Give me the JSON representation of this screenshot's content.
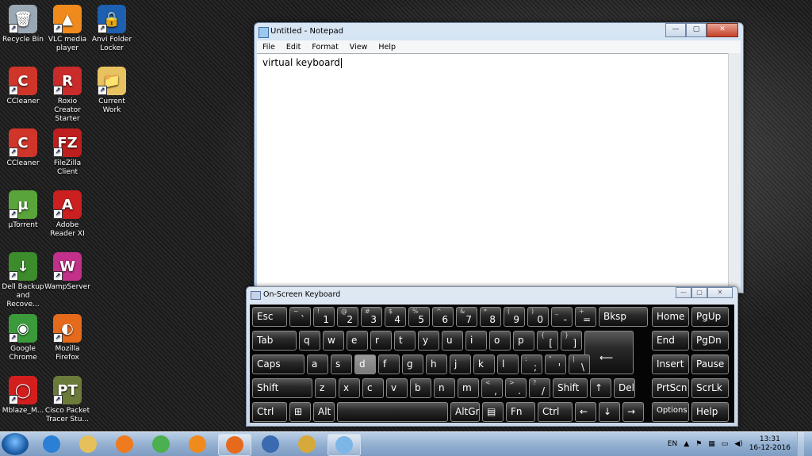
{
  "desktop": {
    "icons": [
      {
        "label": "Recycle Bin",
        "icon": "recycle-bin-icon",
        "color": "#9aa7b5",
        "glyph": "🗑"
      },
      {
        "label": "VLC media player",
        "icon": "vlc-icon",
        "color": "#f08a1c",
        "glyph": "▲"
      },
      {
        "label": "Anvi Folder Locker",
        "icon": "folder-locker-icon",
        "color": "#1d5fb0",
        "glyph": "🔒"
      },
      {
        "label": "CCleaner",
        "icon": "ccleaner-icon",
        "color": "#d0352a",
        "glyph": "C"
      },
      {
        "label": "Roxio Creator Starter",
        "icon": "roxio-icon",
        "color": "#c92b2b",
        "glyph": "R"
      },
      {
        "label": "Current Work",
        "icon": "folder-icon",
        "color": "#e8c260",
        "glyph": "📁"
      },
      {
        "label": "CCleaner",
        "icon": "ccleaner-icon",
        "color": "#d0352a",
        "glyph": "C"
      },
      {
        "label": "FileZilla Client",
        "icon": "filezilla-icon",
        "color": "#bf1e1e",
        "glyph": "FZ"
      },
      {
        "label": "µTorrent",
        "icon": "utorrent-icon",
        "color": "#5aa53a",
        "glyph": "µ"
      },
      {
        "label": "Adobe Reader XI",
        "icon": "adobe-reader-icon",
        "color": "#cc1f1f",
        "glyph": "A"
      },
      {
        "label": "Dell Backup and Recove...",
        "icon": "dell-backup-icon",
        "color": "#3c8b2c",
        "glyph": "↓"
      },
      {
        "label": "WampServer",
        "icon": "wampserver-icon",
        "color": "#c2308a",
        "glyph": "W"
      },
      {
        "label": "Google Chrome",
        "icon": "chrome-icon",
        "color": "#3b9b3b",
        "glyph": "◉"
      },
      {
        "label": "Mozilla Firefox",
        "icon": "firefox-icon",
        "color": "#e66a1c",
        "glyph": "◐"
      },
      {
        "label": "Mblaze_M...",
        "icon": "mblaze-icon",
        "color": "#d31e1e",
        "glyph": "◯"
      },
      {
        "label": "Cisco Packet Tracer Stu...",
        "icon": "packet-tracer-icon",
        "color": "#6b7b3a",
        "glyph": "PT"
      }
    ]
  },
  "notepad": {
    "title": "Untitled - Notepad",
    "menu": [
      "File",
      "Edit",
      "Format",
      "View",
      "Help"
    ],
    "text": "virtual keyboard",
    "buttons": {
      "minimize": "—",
      "maximize": "▢",
      "close": "✕"
    }
  },
  "osk": {
    "title": "On-Screen Keyboard",
    "buttons": {
      "minimize": "—",
      "maximize": "▢",
      "close": "✕"
    },
    "rows": [
      [
        {
          "main": "Esc",
          "w": 44
        },
        {
          "shift": "~",
          "low": "`",
          "w": 27
        },
        {
          "shift": "!",
          "low": "1",
          "w": 27
        },
        {
          "shift": "@",
          "low": "2",
          "w": 27
        },
        {
          "shift": "#",
          "low": "3",
          "w": 27
        },
        {
          "shift": "$",
          "low": "4",
          "w": 27
        },
        {
          "shift": "%",
          "low": "5",
          "w": 27
        },
        {
          "shift": "^",
          "low": "6",
          "w": 27
        },
        {
          "shift": "&",
          "low": "7",
          "w": 27
        },
        {
          "shift": "*",
          "low": "8",
          "w": 27
        },
        {
          "shift": "(",
          "low": "9",
          "w": 27
        },
        {
          "shift": ")",
          "low": "0",
          "w": 27
        },
        {
          "shift": "_",
          "low": "-",
          "w": 27
        },
        {
          "shift": "+",
          "low": "=",
          "w": 27
        },
        {
          "main": "Bksp",
          "w": 62
        }
      ],
      [
        {
          "main": "Tab",
          "w": 56
        },
        {
          "main": "q",
          "w": 27
        },
        {
          "main": "w",
          "w": 27
        },
        {
          "main": "e",
          "w": 27
        },
        {
          "main": "r",
          "w": 27
        },
        {
          "main": "t",
          "w": 27
        },
        {
          "main": "y",
          "w": 27
        },
        {
          "main": "u",
          "w": 27
        },
        {
          "main": "i",
          "w": 27
        },
        {
          "main": "o",
          "w": 27
        },
        {
          "main": "p",
          "w": 27
        },
        {
          "shift": "{",
          "low": "[",
          "w": 27
        },
        {
          "shift": "}",
          "low": "]",
          "w": 27
        },
        {
          "main": "⟵",
          "w": 62,
          "enter": true
        }
      ],
      [
        {
          "main": "Caps",
          "w": 66
        },
        {
          "main": "a",
          "w": 27
        },
        {
          "main": "s",
          "w": 27
        },
        {
          "main": "d",
          "w": 27,
          "pressed": true
        },
        {
          "main": "f",
          "w": 27
        },
        {
          "main": "g",
          "w": 27
        },
        {
          "main": "h",
          "w": 27
        },
        {
          "main": "j",
          "w": 27
        },
        {
          "main": "k",
          "w": 27
        },
        {
          "main": "l",
          "w": 27
        },
        {
          "shift": ":",
          "low": ";",
          "w": 27
        },
        {
          "shift": "\"",
          "low": "'",
          "w": 27
        },
        {
          "shift": "|",
          "low": "\\",
          "w": 27
        }
      ],
      [
        {
          "main": "Shift",
          "w": 76
        },
        {
          "main": "z",
          "w": 27
        },
        {
          "main": "x",
          "w": 27
        },
        {
          "main": "c",
          "w": 27
        },
        {
          "main": "v",
          "w": 27
        },
        {
          "main": "b",
          "w": 27
        },
        {
          "main": "n",
          "w": 27
        },
        {
          "main": "m",
          "w": 27
        },
        {
          "shift": "<",
          "low": ",",
          "w": 27
        },
        {
          "shift": ">",
          "low": ".",
          "w": 27
        },
        {
          "shift": "?",
          "low": "/",
          "w": 27
        },
        {
          "main": "Shift",
          "w": 44
        },
        {
          "main": "↑",
          "w": 27
        },
        {
          "main": "Del",
          "w": 27
        }
      ],
      [
        {
          "main": "Ctrl",
          "w": 44
        },
        {
          "main": "⊞",
          "w": 27
        },
        {
          "main": "Alt",
          "w": 27
        },
        {
          "main": "",
          "w": 140
        },
        {
          "main": "AltGr",
          "w": 37
        },
        {
          "main": "▤",
          "w": 27
        },
        {
          "main": "Fn",
          "w": 37
        },
        {
          "main": "Ctrl",
          "w": 44
        },
        {
          "main": "←",
          "w": 27
        },
        {
          "main": "↓",
          "w": 27
        },
        {
          "main": "→",
          "w": 27
        }
      ]
    ],
    "nav": [
      [
        "Home",
        "PgUp"
      ],
      [
        "End",
        "PgDn"
      ],
      [
        "Insert",
        "Pause"
      ],
      [
        "PrtScn",
        "ScrLk"
      ],
      [
        "Options",
        "Help"
      ]
    ]
  },
  "taskbar": {
    "items": [
      {
        "icon": "internet-explorer-icon",
        "color": "#2b7fd4"
      },
      {
        "icon": "file-explorer-icon",
        "color": "#e6c15a"
      },
      {
        "icon": "media-player-icon",
        "color": "#f07a1e"
      },
      {
        "icon": "chrome-icon",
        "color": "#4caf50"
      },
      {
        "icon": "vlc-icon",
        "color": "#f08a1c"
      },
      {
        "icon": "firefox-icon",
        "color": "#e66a1c",
        "active": true
      },
      {
        "icon": "network-icon",
        "color": "#3a6ab0"
      },
      {
        "icon": "paint-icon",
        "color": "#d7a93a"
      },
      {
        "icon": "notepad-icon",
        "color": "#7cb6e6",
        "active": true
      }
    ],
    "tray": {
      "language": "EN",
      "time": "13:31",
      "date": "16-12-2016"
    }
  }
}
